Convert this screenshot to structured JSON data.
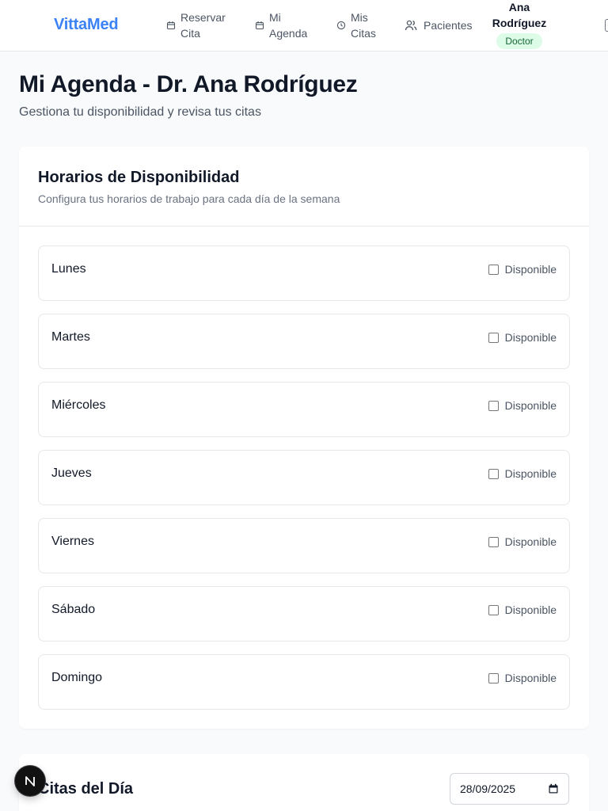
{
  "app": {
    "brand": "VittaMed"
  },
  "nav": {
    "items": [
      {
        "label": "Reservar Cita",
        "icon": "calendar-icon"
      },
      {
        "label": "Mi Agenda",
        "icon": "calendar-icon"
      },
      {
        "label": "Mis Citas",
        "icon": "clock-icon"
      },
      {
        "label": "Pacientes",
        "icon": "users-icon"
      }
    ]
  },
  "user": {
    "name": "Ana Rodríguez",
    "role": "Doctor"
  },
  "page": {
    "title": "Mi Agenda - Dr. Ana Rodríguez",
    "subtitle": "Gestiona tu disponibilidad y revisa tus citas"
  },
  "availability": {
    "title": "Horarios de Disponibilidad",
    "description": "Configura tus horarios de trabajo para cada día de la semana",
    "checkbox_label": "Disponible",
    "days": [
      {
        "name": "Lunes",
        "available": false
      },
      {
        "name": "Martes",
        "available": false
      },
      {
        "name": "Miércoles",
        "available": false
      },
      {
        "name": "Jueves",
        "available": false
      },
      {
        "name": "Viernes",
        "available": false
      },
      {
        "name": "Sábado",
        "available": false
      },
      {
        "name": "Domingo",
        "available": false
      }
    ]
  },
  "appointments": {
    "title": "Citas del Día",
    "date_value": "28/09/2025"
  },
  "colors": {
    "brand": "#3b82f6",
    "badge_bg": "#dcfce7",
    "badge_text": "#166534"
  }
}
